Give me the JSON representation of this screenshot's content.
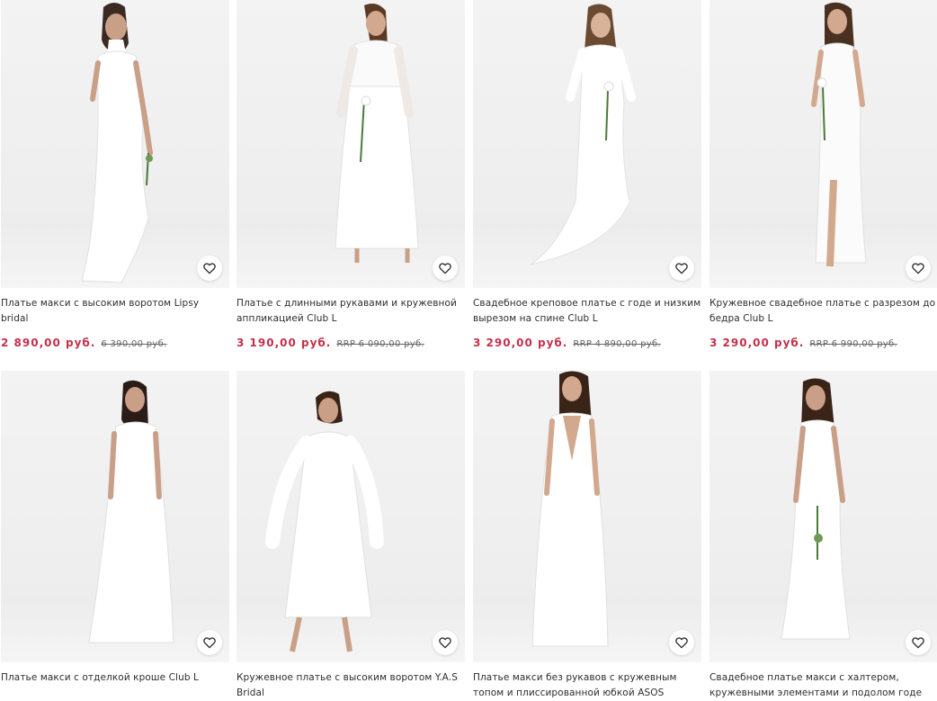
{
  "products": [
    {
      "title": "Платье макси с высоким воротом Lipsy bridal",
      "price": "2 890,00 руб.",
      "old_price": "6 390,00 руб.",
      "favorite_icon": "heart-icon"
    },
    {
      "title": "Платье с длинными рукавами и кружевной аппликацией Club L",
      "price": "3 190,00 руб.",
      "old_price": "RRP 6 090,00 руб.",
      "favorite_icon": "heart-icon"
    },
    {
      "title": "Свадебное креповое платье с годе и низким вырезом на спине Club L",
      "price": "3 290,00 руб.",
      "old_price": "RRP 4 890,00 руб.",
      "favorite_icon": "heart-icon"
    },
    {
      "title": "Кружевное свадебное платье с разрезом до бедра Club L",
      "price": "3 290,00 руб.",
      "old_price": "RRP 6 990,00 руб.",
      "favorite_icon": "heart-icon"
    },
    {
      "title": "Платье макси с отделкой кроше Club L",
      "favorite_icon": "heart-icon"
    },
    {
      "title": "Кружевное платье с высоким воротом Y.A.S Bridal",
      "favorite_icon": "heart-icon"
    },
    {
      "title": "Платье макси без рукавов с кружевным топом и плиссированной юбкой ASOS DESIGN",
      "favorite_icon": "heart-icon"
    },
    {
      "title": "Свадебное платье макси с халтером, кружевными элементами и подолом годе City Goddess",
      "favorite_icon": "heart-icon"
    }
  ],
  "colors": {
    "sale_price": "#c4304a",
    "text": "#2d2d2d",
    "old_price": "#666666",
    "photo_background": "#efefef"
  }
}
